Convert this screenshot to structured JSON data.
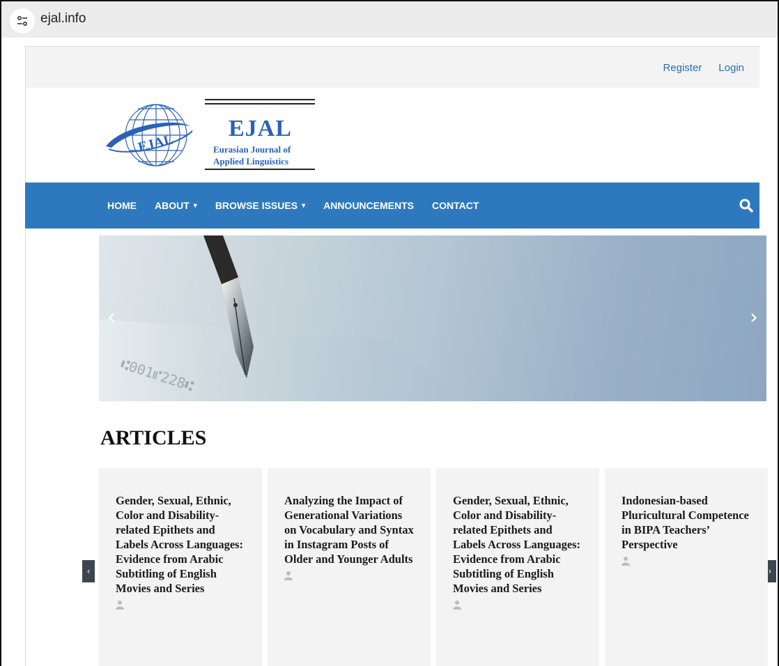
{
  "browser": {
    "url": "ejal.info"
  },
  "top_links": {
    "register": "Register",
    "login": "Login"
  },
  "logo": {
    "title": "EJAL",
    "subtitle_line1": "Eurasian Journal of",
    "subtitle_line2": "Applied Linguistics",
    "emblem_text": "EJAL"
  },
  "nav": {
    "items": [
      {
        "label": "HOME",
        "dropdown": false
      },
      {
        "label": "ABOUT",
        "dropdown": true
      },
      {
        "label": "BROWSE ISSUES",
        "dropdown": true
      },
      {
        "label": "ANNOUNCEMENTS",
        "dropdown": false
      },
      {
        "label": "CONTACT",
        "dropdown": false
      }
    ]
  },
  "banner": {
    "prev": "‹",
    "next": "›"
  },
  "articles": {
    "heading": "ARTICLES",
    "items": [
      {
        "title": "Gender, Sexual, Ethnic, Color and Disability-related Epithets and Labels Across Languages: Evidence from Arabic Subtitling of English Movies and Series"
      },
      {
        "title": "Analyzing the Impact of Generational Variations on Vocabulary and Syntax in Instagram Posts of Older and Younger Adults"
      },
      {
        "title": "Gender, Sexual, Ethnic, Color and Disability-related Epithets and Labels Across Languages: Evidence from Arabic Subtitling of English Movies and Series"
      },
      {
        "title": "Indonesian-based Pluricultural Competence in BIPA Teachers’ Perspective"
      }
    ],
    "prev": "‹",
    "next": "›"
  },
  "colors": {
    "nav_blue": "#2e79be",
    "link_blue": "#2d6ea8",
    "logo_blue": "#2962b8",
    "card_bg": "#f3f3f3"
  }
}
